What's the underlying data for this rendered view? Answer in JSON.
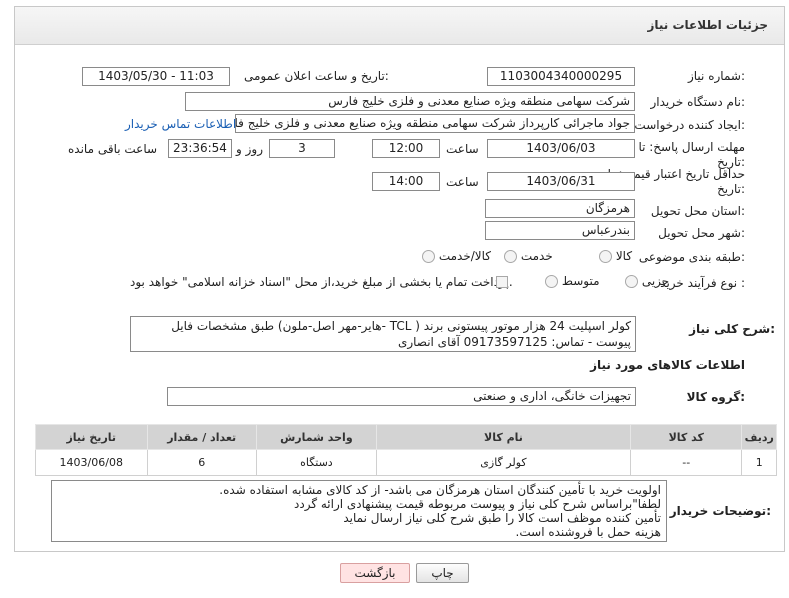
{
  "header": {
    "title": "جزئیات اطلاعات نیاز"
  },
  "fields": {
    "need_number_label": "شماره نیاز:",
    "need_number": "1103004340000295",
    "announce_label": "تاریخ و ساعت اعلان عمومی:",
    "announce_value": "1403/05/30 - 11:03",
    "buyer_label": "نام دستگاه خریدار:",
    "buyer_value": "شرکت سهامی منطقه ویژه صنایع معدنی و فلزی خلیج فارس",
    "requester_label": "ایجاد کننده درخواست:",
    "requester_value": "جواد ماجرائی کارپرداز شرکت سهامی منطقه ویژه صنایع معدنی و فلزی خلیج فار",
    "buyer_contact_link": "اطلاعات تماس خریدار",
    "deadline_label_1": "مهلت ارسال پاسخ: تا",
    "deadline_label_2": "تاریخ:",
    "deadline_date": "1403/06/03",
    "time_label": "ساعت",
    "deadline_time": "12:00",
    "days_value": "3",
    "days_and_label": "روز و",
    "remaining_time": "23:36:54",
    "remaining_label": "ساعت باقی مانده",
    "validity_label_1": "حداقل تاریخ اعتبار قیمت: تا",
    "validity_label_2": "تاریخ:",
    "validity_date": "1403/06/31",
    "validity_time": "14:00",
    "province_label": "استان محل تحویل:",
    "province_value": "هرمزگان",
    "city_label": "شهر محل تحویل:",
    "city_value": "بندرعباس",
    "category_label": "طبقه بندی موضوعی:",
    "category_options": [
      "کالا",
      "خدمت",
      "کالا/خدمت"
    ],
    "process_label": "نوع فرآیند خرید :",
    "process_options": [
      "جزیی",
      "متوسط"
    ],
    "payment_note": "پرداخت تمام یا بخشی از مبلغ خرید،از محل \"اسناد خزانه اسلامی\" خواهد بود."
  },
  "description": {
    "label": "شرح کلی نیاز:",
    "text": "کولر اسپلیت 24 هزار موتور پیستونی برند ( TCL -هایر-مهر اصل-ملون) طبق مشخصات فایل پیوست - تماس: 09173597125 آقای انصاری"
  },
  "goods": {
    "section_title": "اطلاعات کالاهای مورد نیاز",
    "group_label": "گروه کالا:",
    "group_value": "تجهیزات خانگی، اداری و صنعتی",
    "columns": [
      "ردیف",
      "کد کالا",
      "نام کالا",
      "واحد شمارش",
      "تعداد / مقدار",
      "تاریخ نیاز"
    ],
    "rows": [
      [
        "1",
        "--",
        "کولر گازی",
        "دستگاه",
        "6",
        "1403/06/08"
      ]
    ]
  },
  "buyer_notes": {
    "label": "توضیحات خریدار:",
    "lines": [
      "اولویت خرید با تأمین کنندگان استان هرمزگان می باشد- از کد کالای مشابه استفاده شده.",
      "لطفا\"براساس شرح کلی نیاز و پیوست مربوطه قیمت پیشنهادی ارائه گردد",
      "تأمین کننده موظف است کالا را طبق شرح کلی نیاز ارسال نماید",
      "هزینه حمل با فروشنده است."
    ]
  },
  "buttons": {
    "print": "چاپ",
    "back": "بازگشت"
  }
}
